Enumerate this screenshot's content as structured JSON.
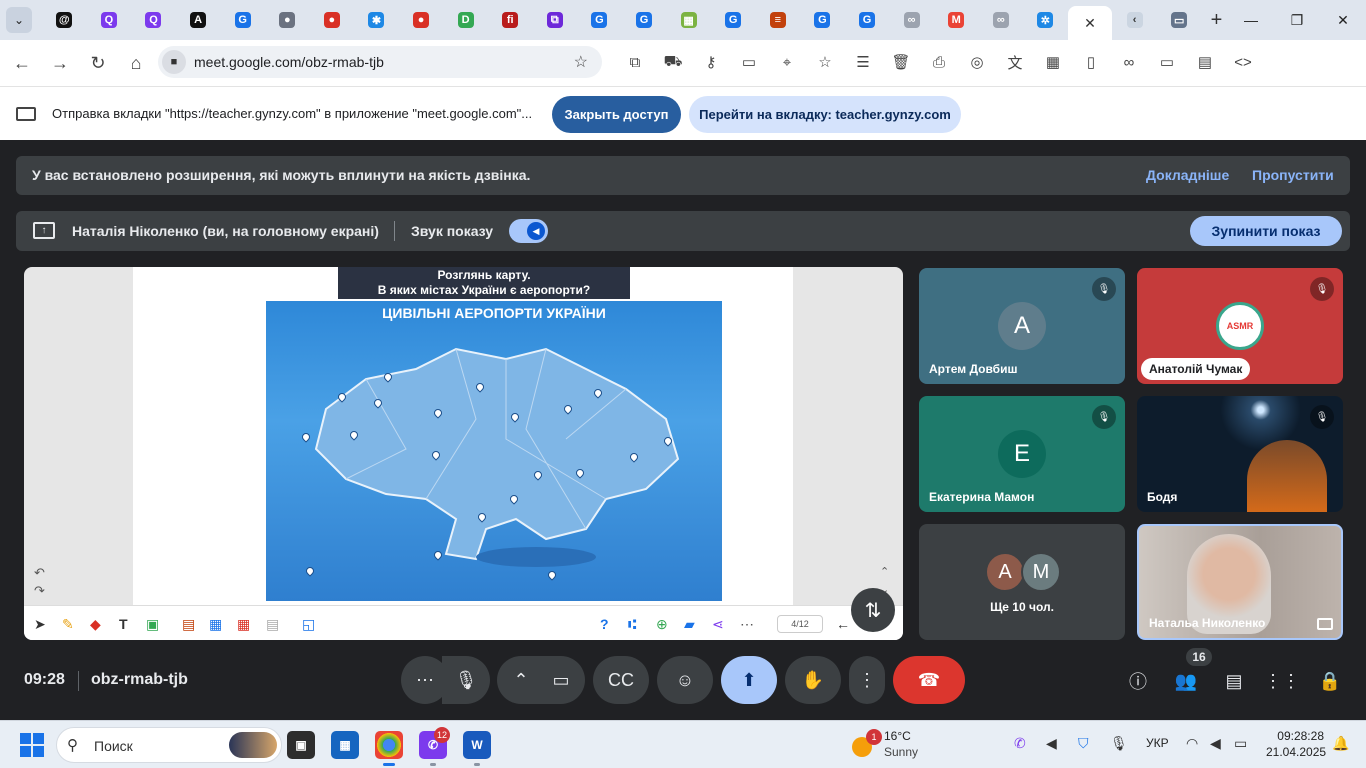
{
  "browser": {
    "url": "meet.google.com/obz-rmab-tjb",
    "tabs": [
      {
        "icon": "threads-icon",
        "color": "#111111",
        "glyph": "@"
      },
      {
        "icon": "quizizz-icon",
        "color": "#7c3aed",
        "glyph": "Q"
      },
      {
        "icon": "quizizz-icon",
        "color": "#7c3aed",
        "glyph": "Q"
      },
      {
        "icon": "canva-icon",
        "color": "#111111",
        "glyph": "A"
      },
      {
        "icon": "google-icon",
        "color": "#1a73e8",
        "glyph": "G"
      },
      {
        "icon": "globe-icon",
        "color": "#6b7280",
        "glyph": "●"
      },
      {
        "icon": "red-ball-icon",
        "color": "#d93025",
        "glyph": "●"
      },
      {
        "icon": "puzzle-app-icon",
        "color": "#1e88e5",
        "glyph": "✱"
      },
      {
        "icon": "red-ball-icon",
        "color": "#d93025",
        "glyph": "●"
      },
      {
        "icon": "d-app-icon",
        "color": "#34a853",
        "glyph": "D"
      },
      {
        "icon": "fi-app-icon",
        "color": "#b91c1c",
        "glyph": "fi"
      },
      {
        "icon": "wordwall-icon",
        "color": "#6d28d9",
        "glyph": "⧉"
      },
      {
        "icon": "gynzy-icon",
        "color": "#1a73e8",
        "glyph": "G"
      },
      {
        "icon": "gynzy-icon",
        "color": "#1a73e8",
        "glyph": "G"
      },
      {
        "icon": "learningapps-icon",
        "color": "#7cb342",
        "glyph": "▦"
      },
      {
        "icon": "gynzy-icon",
        "color": "#1a73e8",
        "glyph": "G"
      },
      {
        "icon": "book-icon",
        "color": "#c2410c",
        "glyph": "≡"
      },
      {
        "icon": "gynzy-icon",
        "color": "#1a73e8",
        "glyph": "G"
      },
      {
        "icon": "gynzy-icon",
        "color": "#1a73e8",
        "glyph": "G"
      },
      {
        "icon": "link-icon",
        "color": "#9ca3af",
        "glyph": "∞"
      },
      {
        "icon": "gmail-icon",
        "color": "#ea4335",
        "glyph": "M"
      },
      {
        "icon": "link-icon",
        "color": "#9ca3af",
        "glyph": "∞"
      },
      {
        "icon": "snowflake-icon",
        "color": "#1e88e5",
        "glyph": "✲"
      }
    ]
  },
  "share_bar": {
    "message": "Отправка вкладки \"https://teacher.gynzy.com\" в приложение \"meet.google.com\"...",
    "stop_button": "Закрыть доступ",
    "goto_button": "Перейти на вкладку: teacher.gynzy.com"
  },
  "meet": {
    "warning": {
      "text": "У вас встановлено розширення, які можуть вплинути на якість дзвінка.",
      "learn_more": "Докладніше",
      "skip": "Пропустити"
    },
    "presenting": {
      "name": "Наталія Ніколенко (ви, на головному екрані)",
      "sound_label": "Звук показу",
      "sound_on": true,
      "stop_button": "Зупинити показ"
    },
    "slide": {
      "title_line1": "Розглянь карту.",
      "title_line2": "В яких містах України є аеропорти?",
      "map_title": "ЦИВІЛЬНІ АЕРОПОРТИ УКРАЇНИ",
      "page_indicator": "4/12"
    },
    "participants": [
      {
        "name": "Артем Довбиш",
        "initial": "A",
        "bg": "#3f6f82",
        "avatar_bg": "#5f7d8c",
        "muted": true
      },
      {
        "name": "Анатолій Чумак",
        "initial": "",
        "bg": "#c53b3b",
        "avatar_bg": "#ffffff",
        "muted": true,
        "tag": true,
        "logo": "ASMR"
      },
      {
        "name": "Екатерина Мамон",
        "initial": "E",
        "bg": "#1e7a6b",
        "avatar_bg": "#0d6b5c",
        "muted": true
      },
      {
        "name": "Бодя",
        "initial": "",
        "bg": "#0d1c2c",
        "muted": true,
        "video": true
      },
      {
        "name": "Ще 10 чол.",
        "initial": "",
        "bg": "#3c4043",
        "muted": false,
        "group": true,
        "mini": [
          "A",
          "M"
        ]
      },
      {
        "name": "Натальа Николенко",
        "initial": "",
        "bg": "#bfb6b0",
        "muted": false,
        "video": true,
        "self": true
      }
    ],
    "bottom": {
      "time": "09:28",
      "meeting_code": "obz-rmab-tjb",
      "people_count": "16"
    }
  },
  "taskbar": {
    "search_placeholder": "Поиск",
    "chat_badge": "12",
    "weather_badge": "1",
    "weather_temp": "16°C",
    "weather_cond": "Sunny",
    "language": "УКР",
    "time": "09:28:28",
    "date": "21.04.2025"
  }
}
